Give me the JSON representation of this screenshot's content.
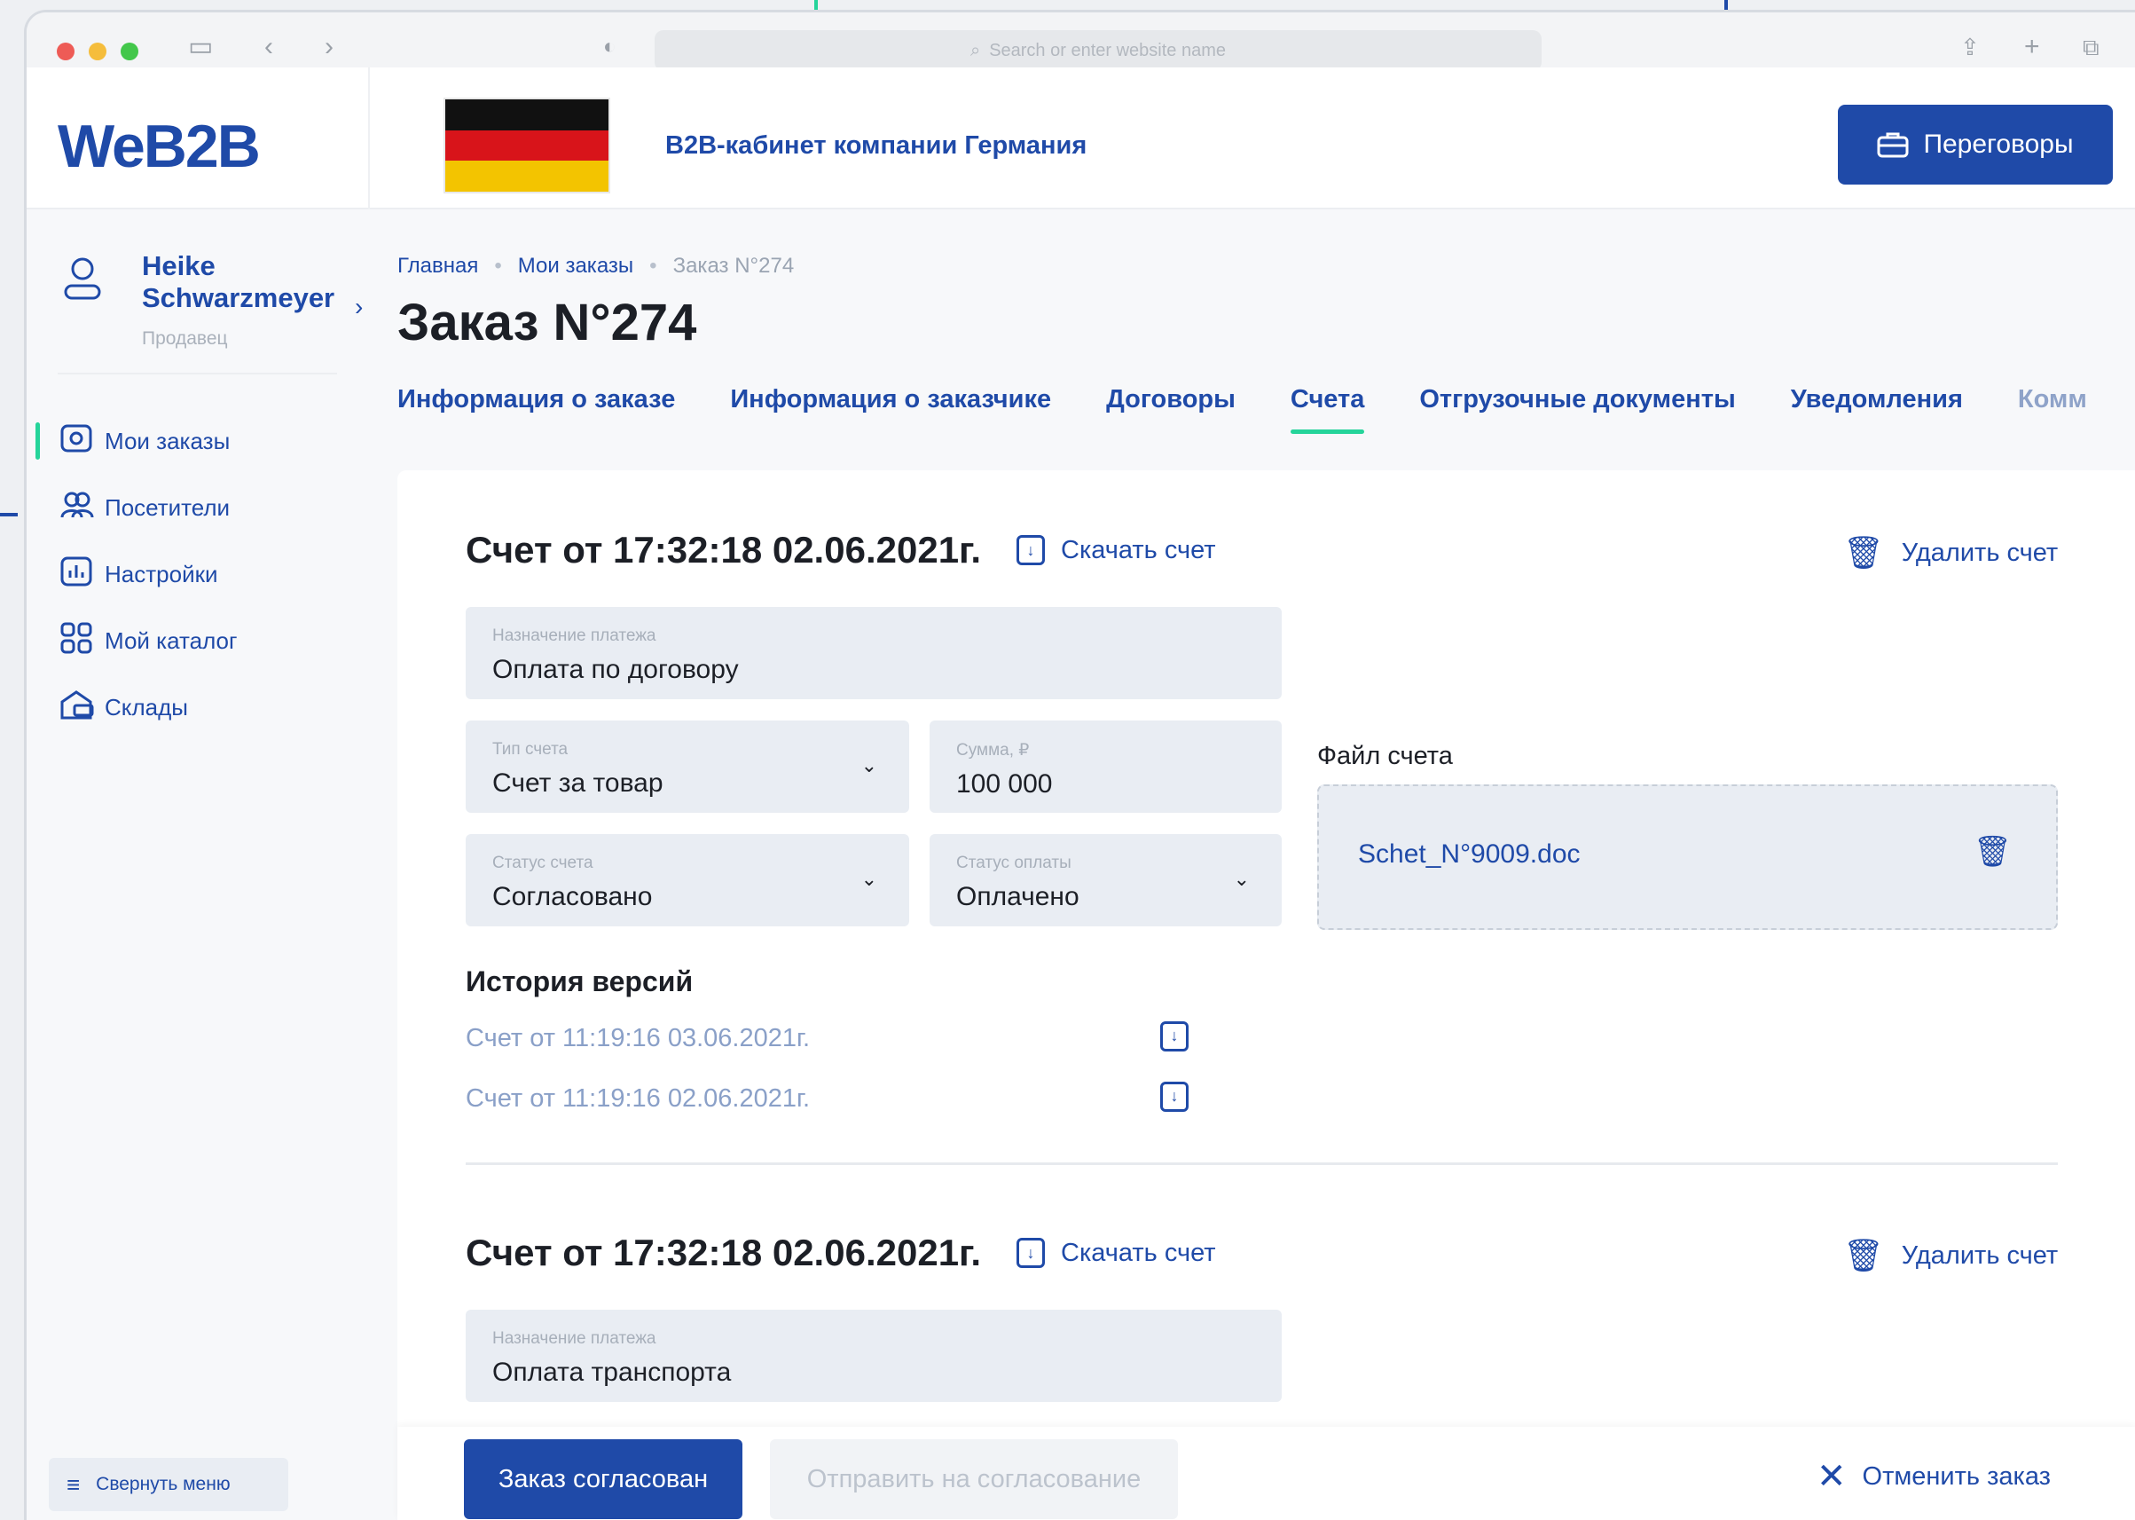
{
  "colors": {
    "accent": "#1f4aa8",
    "active_indicator": "#25d49a",
    "field_bg": "#e9edf3"
  },
  "browser": {
    "address_placeholder": "Search or enter website name"
  },
  "header": {
    "logo": "WeB2B",
    "company_title": "B2B-кабинет компании Германия",
    "negotiations_button": "Переговоры"
  },
  "user": {
    "name": "Heike Schwarzmeyer",
    "role": "Продавец"
  },
  "sidebar": {
    "items": [
      {
        "label": "Мои заказы",
        "icon": "orders-icon"
      },
      {
        "label": "Посетители",
        "icon": "visitors-icon"
      },
      {
        "label": "Настройки",
        "icon": "settings-chart-icon"
      },
      {
        "label": "Мой каталог",
        "icon": "catalog-icon"
      },
      {
        "label": "Склады",
        "icon": "warehouse-icon"
      }
    ],
    "collapse_label": "Свернуть меню"
  },
  "breadcrumb": {
    "home": "Главная",
    "orders": "Мои заказы",
    "current": "Заказ N°274"
  },
  "page_title": "Заказ N°274",
  "tabs": [
    "Информация о заказе",
    "Информация о заказчике",
    "Договоры",
    "Счета",
    "Отгрузочные документы",
    "Уведомления",
    "Комм"
  ],
  "invoice1": {
    "title": "Счет от 17:32:18 02.06.2021г.",
    "download": "Скачать счет",
    "delete": "Удалить счет",
    "purpose_label": "Назначение платежа",
    "purpose_value": "Оплата по договору",
    "type_label": "Тип счета",
    "type_value": "Счет за товар",
    "sum_label": "Сумма, ₽",
    "sum_value": "100 000",
    "status_label": "Статус счета",
    "status_value": "Согласовано",
    "payment_label": "Статус оплаты",
    "payment_value": "Оплачено",
    "file_label": "Файл счета",
    "file_name": "Schet_N°9009.doc",
    "history_title": "История версий",
    "history": [
      "Счет от 11:19:16 03.06.2021г.",
      "Счет от 11:19:16 02.06.2021г."
    ]
  },
  "invoice2": {
    "title": "Счет от 17:32:18 02.06.2021г.",
    "download": "Скачать счет",
    "delete": "Удалить счет",
    "purpose_label": "Назначение платежа",
    "purpose_value": "Оплата транспорта"
  },
  "actions": {
    "approved": "Заказ согласован",
    "send_for_approval": "Отправить на согласование",
    "cancel": "Отменить заказ"
  }
}
